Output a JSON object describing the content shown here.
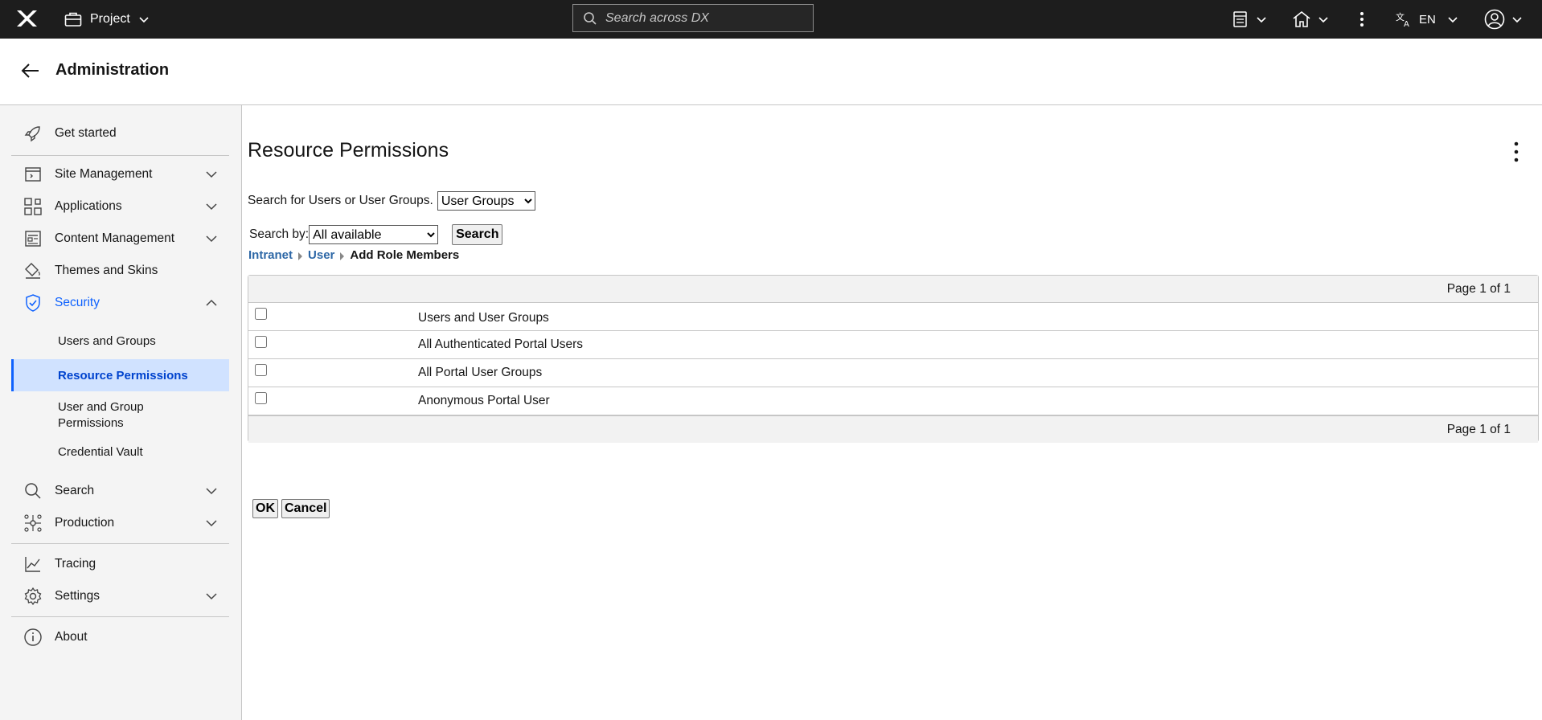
{
  "topbar": {
    "project_label": "Project",
    "search_placeholder": "Search across DX",
    "language": "EN"
  },
  "header": {
    "title": "Administration"
  },
  "sidebar": {
    "get_started": "Get started",
    "site_management": "Site Management",
    "applications": "Applications",
    "content_management": "Content Management",
    "themes_and_skins": "Themes and Skins",
    "security": "Security",
    "security_items": [
      "Users and Groups",
      "Resource Permissions",
      "User and Group Permissions",
      "Credential Vault"
    ],
    "search": "Search",
    "production": "Production",
    "tracing": "Tracing",
    "settings": "Settings",
    "about": "About"
  },
  "main": {
    "title": "Resource Permissions",
    "search_for_label": "Search for Users or User Groups.",
    "search_for_selected": "User Groups",
    "search_by_label": "Search by:",
    "search_by_selected": "All available",
    "search_button": "Search",
    "breadcrumb": [
      "Intranet",
      "User",
      "Add Role Members"
    ],
    "pagination": "Page 1 of 1",
    "table_header": "Users and User Groups",
    "rows": [
      "All Authenticated Portal Users",
      "All Portal User Groups",
      "Anonymous Portal User"
    ],
    "ok_button": "OK",
    "cancel_button": "Cancel"
  },
  "colors": {
    "topbar_bg": "#1d1d1d",
    "accent": "#0f62fe",
    "selected_bg": "#d0e2ff",
    "link": "#2d67a6"
  }
}
